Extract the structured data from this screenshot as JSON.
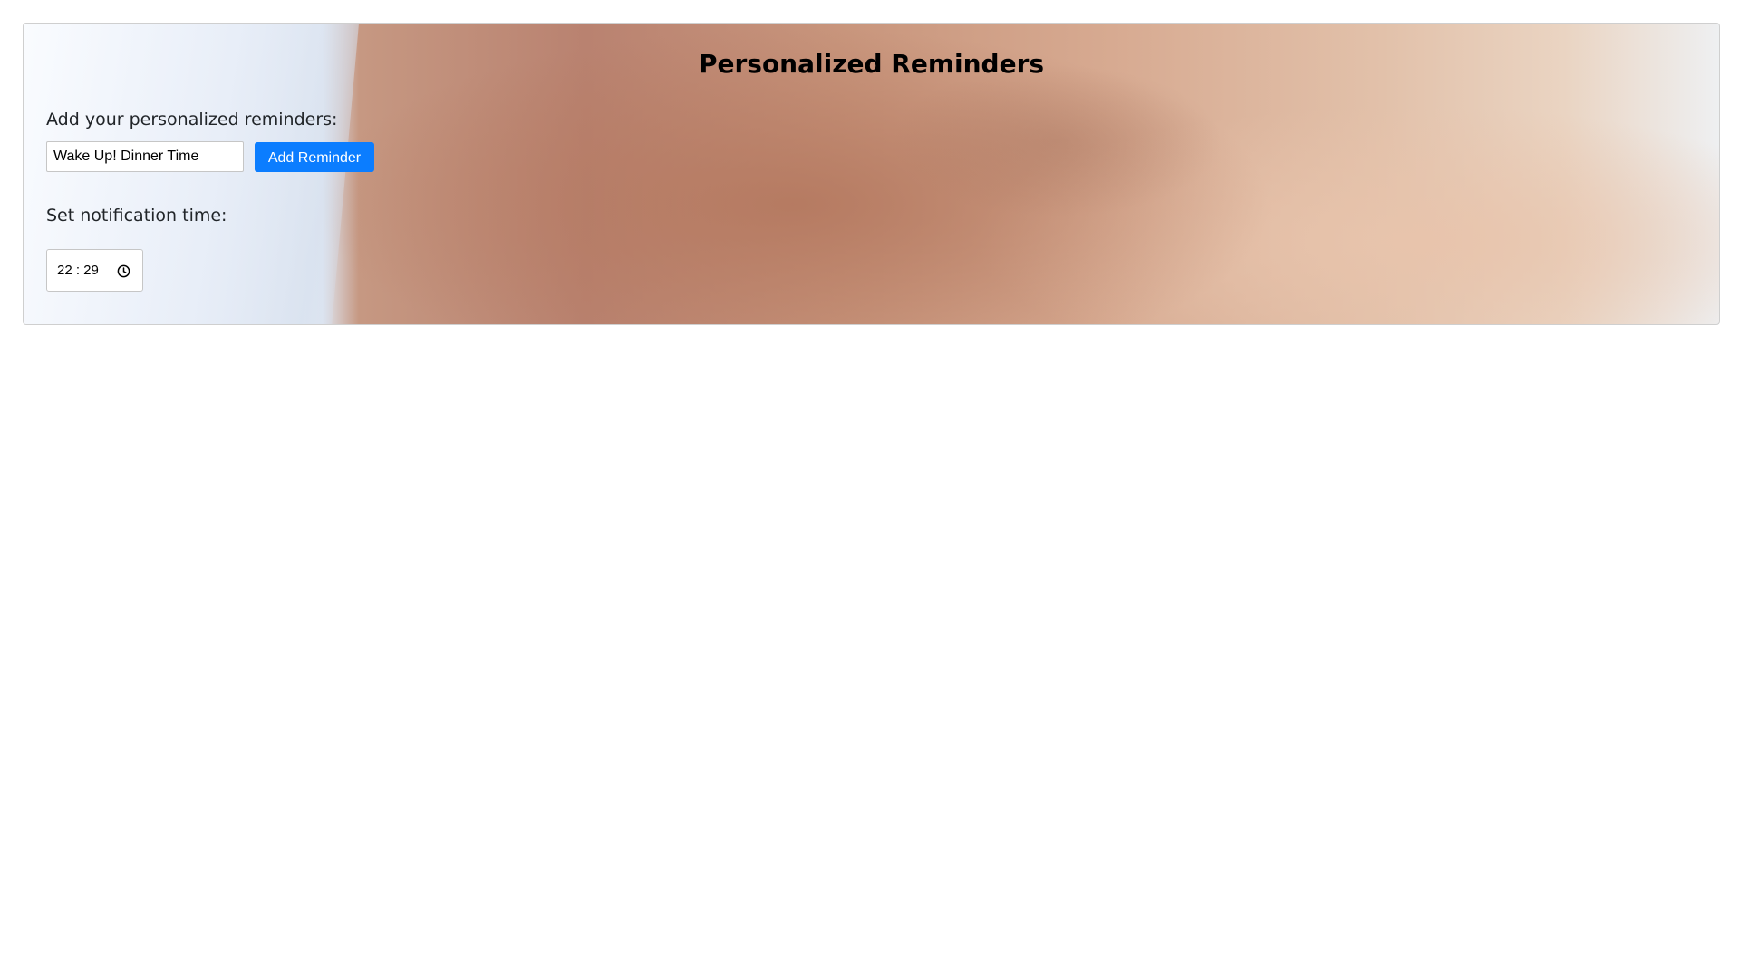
{
  "header": {
    "title": "Personalized Reminders"
  },
  "reminder": {
    "label": "Add your personalized reminders:",
    "input_value": "Wake Up! Dinner Time",
    "button_label": "Add Reminder"
  },
  "notification": {
    "label": "Set notification time:",
    "time_value": "22 : 29",
    "icon": "clock-icon"
  },
  "colors": {
    "button_bg": "#0b7dff",
    "button_text": "#ffffff",
    "title_text": "#000000"
  },
  "background": {
    "description_icon": "hands-photo"
  }
}
